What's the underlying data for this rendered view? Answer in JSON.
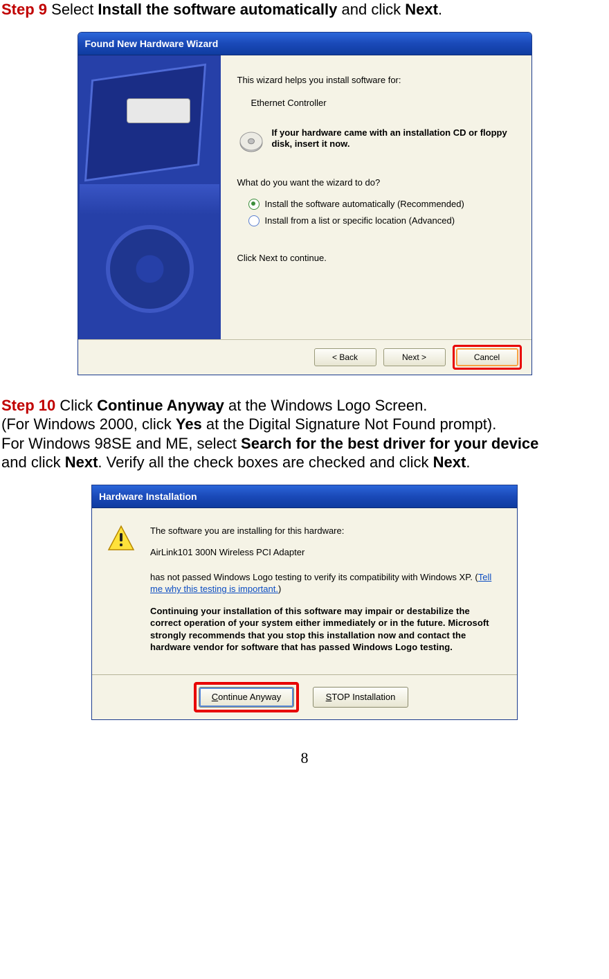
{
  "step9": {
    "label": "Step 9",
    "part1": " Select ",
    "bold1": "Install the software automatically",
    "part2": " and click ",
    "bold2": "Next",
    "part3": "."
  },
  "dlg1": {
    "title": "Found New Hardware Wizard",
    "intro": "This wizard helps you install software for:",
    "device": "Ethernet Controller",
    "cd_text": "If your hardware came with an installation CD or floppy disk, insert it now.",
    "question": "What do you want the wizard to do?",
    "opt1": "Install the software automatically (Recommended)",
    "opt2": "Install from a list or specific location (Advanced)",
    "continue": "Click Next to continue.",
    "btn_back": "< Back",
    "btn_next": "Next >",
    "btn_cancel": "Cancel"
  },
  "step10": {
    "label": "Step 10",
    "l1a": " Click ",
    "l1b": "Continue Anyway",
    "l1c": " at the Windows Logo Screen.",
    "l2a": "(For Windows 2000, click ",
    "l2b": "Yes",
    "l2c": " at the Digital Signature Not Found prompt).",
    "l3a": "For Windows 98SE and ME, select ",
    "l3b": "Search for the best driver for your device",
    "l4a": "and click ",
    "l4b": "Next",
    "l4c": ". Verify all the check boxes are checked and click ",
    "l4d": "Next",
    "l4e": "."
  },
  "dlg2": {
    "title": "Hardware Installation",
    "line1": "The software you are installing for this hardware:",
    "line2": "AirLink101 300N Wireless PCI Adapter",
    "line3a": "has not passed Windows Logo testing to verify its compatibility with Windows XP. (",
    "link": "Tell me why this testing is important.",
    "line3b": ")",
    "warn": "Continuing your installation of this software may impair or destabilize the correct operation of your system either immediately or in the future. Microsoft strongly recommends that you stop this installation now and contact the hardware vendor for software that has passed Windows Logo testing.",
    "btn_continue_pre": "C",
    "btn_continue_rest": "ontinue Anyway",
    "btn_stop_pre": "S",
    "btn_stop_rest": "TOP Installation"
  },
  "page_number": "8"
}
